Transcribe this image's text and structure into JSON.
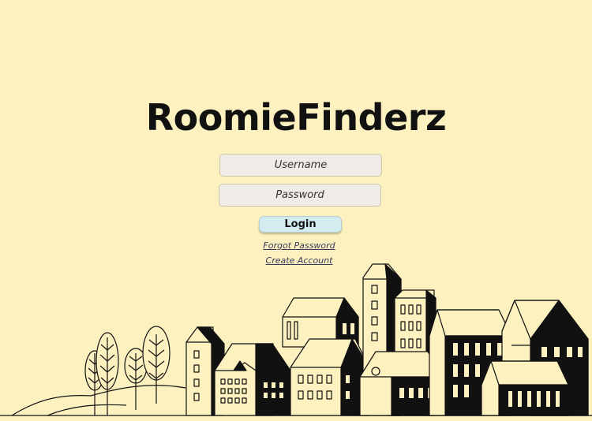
{
  "app": {
    "title": "RoomieFinderz"
  },
  "login_form": {
    "username_placeholder": "Username",
    "password_placeholder": "Password",
    "login_label": "Login",
    "forgot_password_label": "Forgot Password",
    "create_account_label": "Create Account"
  },
  "colors": {
    "background": "#fdf2bf",
    "field_background": "#efebe6",
    "button_background": "#d3ecf0",
    "ink": "#111111"
  },
  "illustration": {
    "icon": "city-skyline-illustration"
  }
}
